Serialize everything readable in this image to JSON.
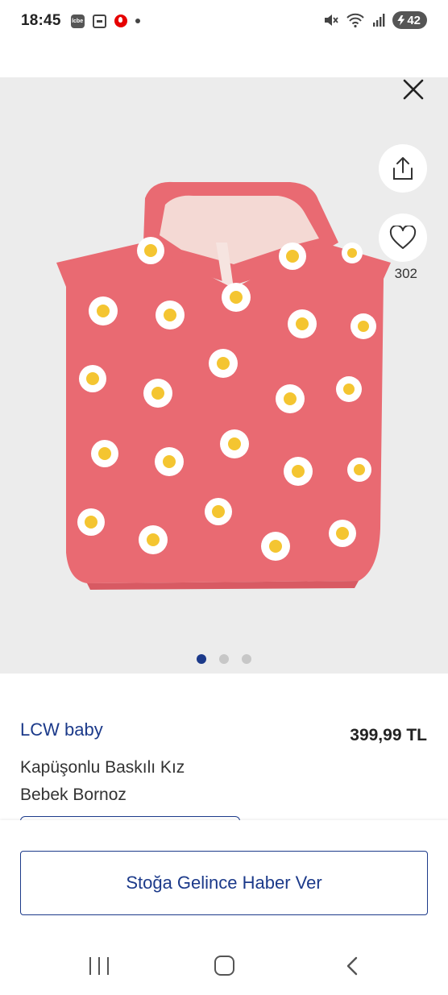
{
  "status_bar": {
    "time": "18:45",
    "carrier_badge": "lcbe",
    "battery": "42"
  },
  "gallery": {
    "favorite_count": "302",
    "image_count": 3,
    "active_index": 0,
    "product_color": "#e96a72"
  },
  "product": {
    "brand": "LCW baby",
    "title": "Kapüşonlu Baskılı Kız Bebek Bornoz",
    "price": "399,99 TL"
  },
  "actions": {
    "notify_label": "Stoğa Gelince Haber Ver"
  },
  "icons": [
    "close-icon",
    "share-icon",
    "heart-icon",
    "recent-apps-icon",
    "home-icon",
    "back-icon"
  ],
  "colors": {
    "brand_blue": "#1c3a8a",
    "background_gray": "#ececec"
  }
}
